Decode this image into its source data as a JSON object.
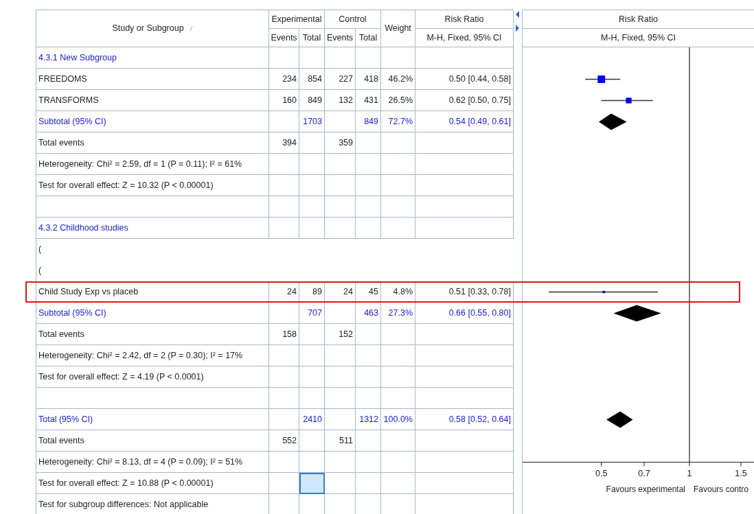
{
  "table": {
    "header": {
      "study": "Study or Subgroup",
      "experimental": "Experimental",
      "control": "Control",
      "exp_events": "Events",
      "exp_total": "Total",
      "ctl_events": "Events",
      "ctl_total": "Total",
      "weight": "Weight",
      "risk_ratio": "Risk Ratio",
      "method": "M-H, Fixed, 95% CI"
    },
    "rows": [
      {
        "kind": "group",
        "label": "4.3.1 New Subgroup",
        "selected": false,
        "highlighted": false
      },
      {
        "kind": "study",
        "label": "FREEDOMS",
        "exp_events": "234",
        "exp_total": "854",
        "ctl_events": "227",
        "ctl_total": "418",
        "weight": "46.2%",
        "ratio": "0.50 [0.44, 0.58]",
        "selected": false,
        "highlighted": false
      },
      {
        "kind": "study",
        "label": "TRANSFORMS",
        "exp_events": "160",
        "exp_total": "849",
        "ctl_events": "132",
        "ctl_total": "431",
        "weight": "26.5%",
        "ratio": "0.62 [0.50, 0.75]",
        "selected": false,
        "highlighted": false
      },
      {
        "kind": "subtotal",
        "label": "Subtotal (95% CI)",
        "exp_total": "1703",
        "ctl_total": "849",
        "weight": "72.7%",
        "ratio": "0.54 [0.49, 0.61]",
        "selected": false,
        "highlighted": false
      },
      {
        "kind": "events",
        "label": "Total events",
        "exp_events": "394",
        "ctl_events": "359",
        "selected": false,
        "highlighted": false
      },
      {
        "kind": "note",
        "label": "Heterogeneity: Chi² = 2.59, df = 1 (P = 0.11); I² = 61%",
        "selected": false,
        "highlighted": false
      },
      {
        "kind": "note",
        "label": "Test for overall effect: Z = 10.32 (P < 0.00001)",
        "selected": false,
        "highlighted": false
      },
      {
        "kind": "blank",
        "selected": false,
        "highlighted": false
      },
      {
        "kind": "group",
        "label": "4.3.2 Childhood studies",
        "selected": false,
        "highlighted": false
      },
      {
        "kind": "hidden",
        "label": "(",
        "selected": false,
        "highlighted": false
      },
      {
        "kind": "hidden",
        "label": "(",
        "selected": false,
        "highlighted": false
      },
      {
        "kind": "study",
        "label": "Child Study Exp vs placeb",
        "exp_events": "24",
        "exp_total": "89",
        "ctl_events": "24",
        "ctl_total": "45",
        "weight": "4.8%",
        "ratio": "0.51 [0.33, 0.78]",
        "selected": false,
        "highlighted": true
      },
      {
        "kind": "subtotal",
        "label": "Subtotal (95% CI)",
        "exp_total": "707",
        "ctl_total": "463",
        "weight": "27.3%",
        "ratio": "0.66 [0.55, 0.80]",
        "selected": false,
        "highlighted": false
      },
      {
        "kind": "events",
        "label": "Total events",
        "exp_events": "158",
        "ctl_events": "152",
        "selected": false,
        "highlighted": false
      },
      {
        "kind": "note",
        "label": "Heterogeneity: Chi² = 2.42, df = 2 (P = 0.30); I² = 17%",
        "selected": false,
        "highlighted": false
      },
      {
        "kind": "note",
        "label": "Test for overall effect: Z = 4.19 (P < 0.0001)",
        "selected": false,
        "highlighted": false
      },
      {
        "kind": "blank",
        "selected": false,
        "highlighted": false
      },
      {
        "kind": "subtotal",
        "label": "Total (95% CI)",
        "exp_total": "2410",
        "ctl_total": "1312",
        "weight": "100.0%",
        "ratio": "0.58 [0.52, 0.64]",
        "selected": false,
        "highlighted": false
      },
      {
        "kind": "events",
        "label": "Total events",
        "exp_events": "552",
        "ctl_events": "511",
        "selected": false,
        "highlighted": false
      },
      {
        "kind": "note",
        "label": "Heterogeneity: Chi² = 8.13, df = 4 (P = 0.09); I² = 51%",
        "selected": false,
        "highlighted": false
      },
      {
        "kind": "note",
        "label": "Test for overall effect: Z = 10.88 (P < 0.00001)",
        "selected": true,
        "highlighted": false
      },
      {
        "kind": "note",
        "label": "Test for subgroup differences: Not applicable",
        "selected": false,
        "highlighted": false
      }
    ]
  },
  "plot": {
    "title": "Risk Ratio",
    "method": "M-H, Fixed, 95% CI",
    "ticks": [
      "0.5",
      "0.7",
      "1",
      "1.5"
    ],
    "favours_left": "Favours experimental",
    "favours_right": "Favours contro"
  }
}
